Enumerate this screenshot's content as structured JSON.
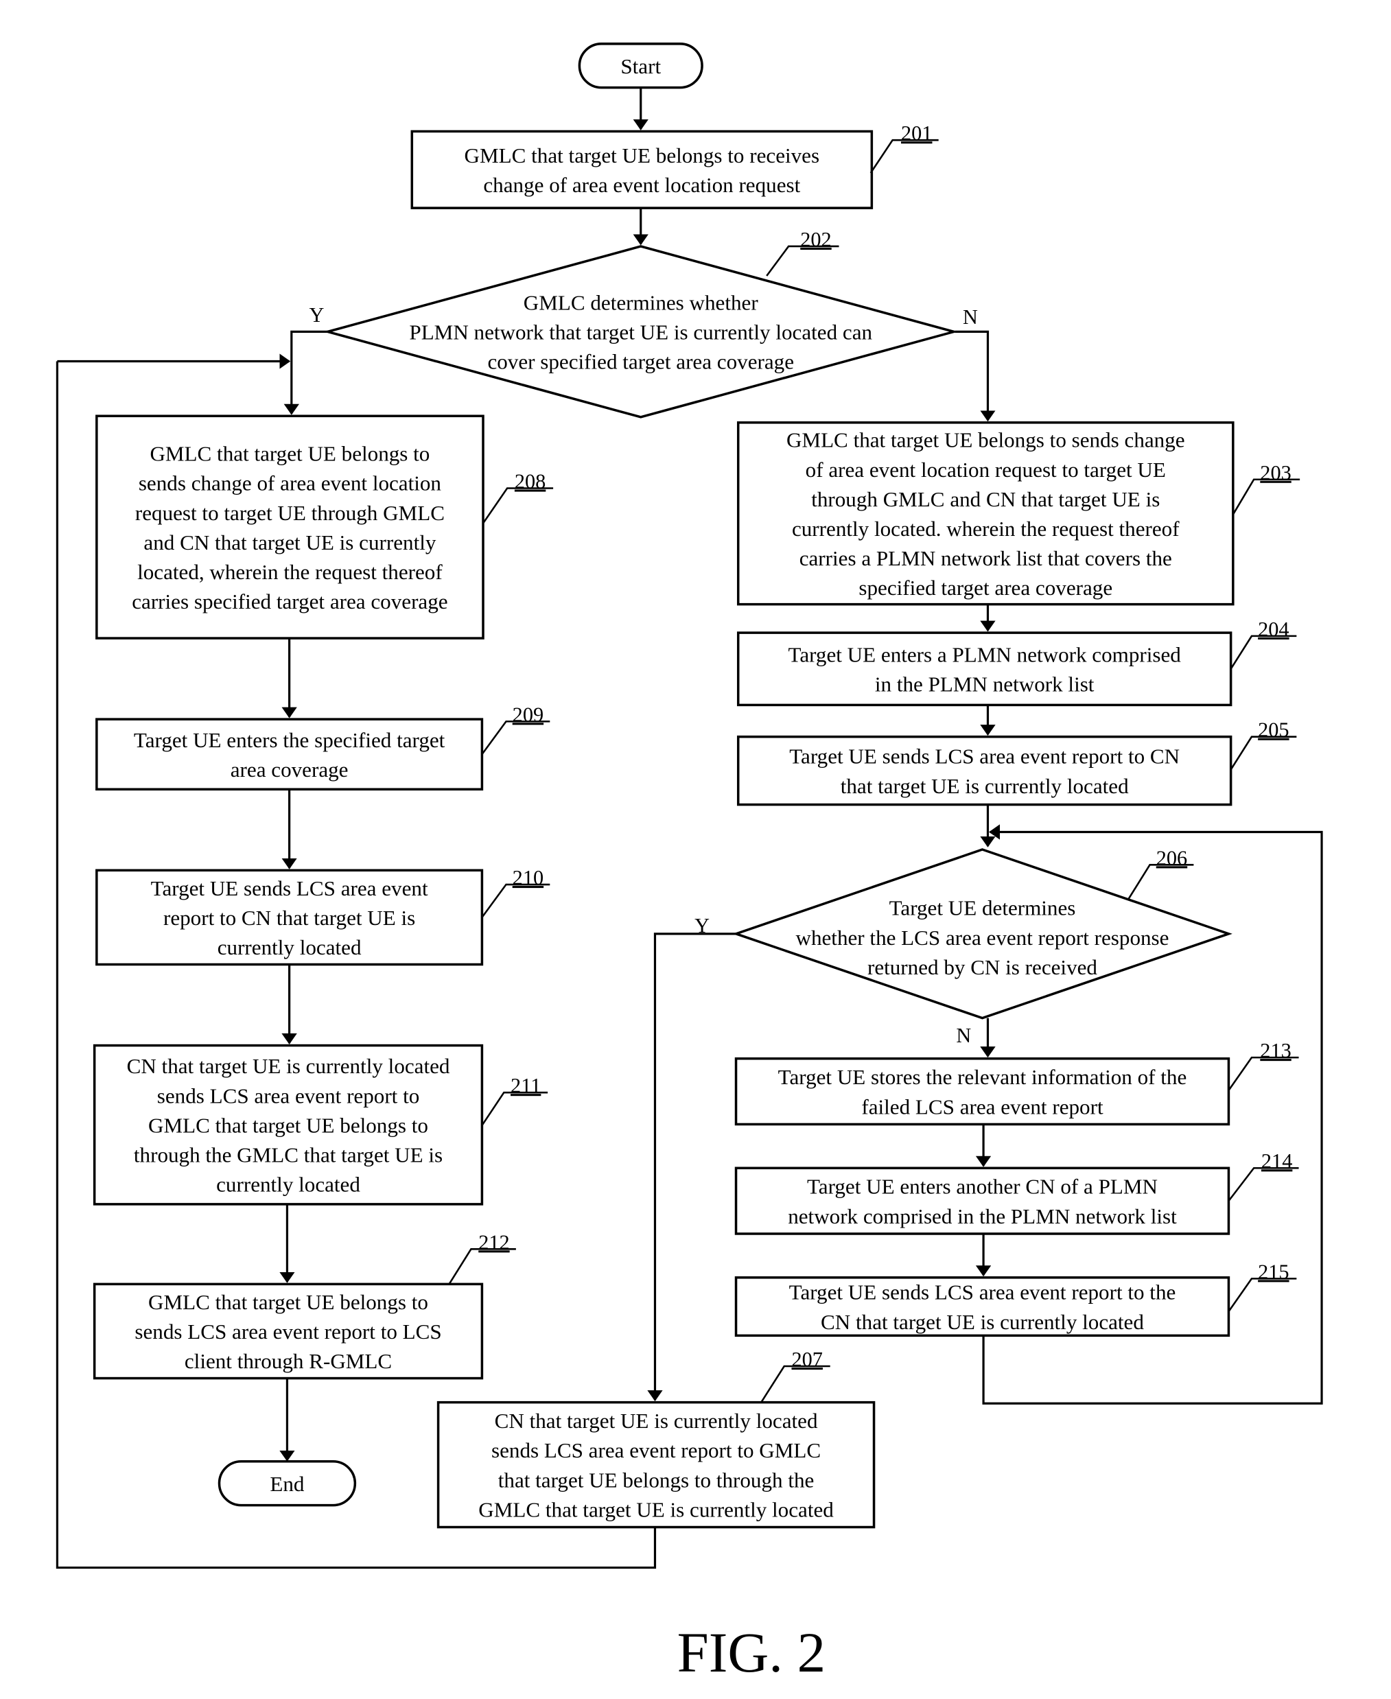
{
  "figure": {
    "caption": "FIG. 2",
    "start_label": "Start",
    "end_label": "End"
  },
  "steps": {
    "s201": {
      "ref": "201",
      "lines": [
        "GMLC that target UE belongs to receives",
        "change of area event location request"
      ]
    },
    "s202": {
      "ref": "202",
      "lines": [
        "GMLC determines whether",
        "PLMN network that target UE is currently located can",
        "cover specified target area coverage"
      ],
      "yes": "Y",
      "no": "N"
    },
    "s203": {
      "ref": "203",
      "lines": [
        "GMLC that target UE belongs to sends change",
        "of area event location request to target UE",
        "through GMLC and CN that target UE is",
        "currently located. wherein the request thereof",
        "carries a PLMN network list that covers the",
        "specified target area coverage"
      ]
    },
    "s204": {
      "ref": "204",
      "lines": [
        "Target UE enters a PLMN network comprised",
        "in the PLMN network list"
      ]
    },
    "s205": {
      "ref": "205",
      "lines": [
        "Target UE sends LCS area event report to CN",
        "that target UE is currently located"
      ]
    },
    "s206": {
      "ref": "206",
      "lines": [
        "Target UE determines",
        "whether the LCS area event report response",
        "returned by CN is received"
      ],
      "yes": "Y",
      "no": "N"
    },
    "s207": {
      "ref": "207",
      "lines": [
        "CN that target UE is currently located",
        "sends LCS area event report to GMLC",
        "that target UE belongs to through the",
        "GMLC that target UE is currently located"
      ]
    },
    "s208": {
      "ref": "208",
      "lines": [
        "GMLC that target UE belongs to",
        "sends change of area event location",
        "request to target UE through GMLC",
        "and CN that target UE is currently",
        "located, wherein the request thereof",
        "carries specified target area coverage"
      ]
    },
    "s209": {
      "ref": "209",
      "lines": [
        "Target UE enters the specified target",
        "area coverage"
      ]
    },
    "s210": {
      "ref": "210",
      "lines": [
        "Target UE sends LCS area event",
        "report to CN that target UE is",
        "currently located"
      ]
    },
    "s211": {
      "ref": "211",
      "lines": [
        "CN that target UE is currently located",
        "sends LCS area event report to",
        "GMLC that target UE belongs to",
        "through the GMLC that target UE is",
        "currently located"
      ]
    },
    "s212": {
      "ref": "212",
      "lines": [
        "GMLC that target UE belongs to",
        "sends LCS area event report to LCS",
        "client through R-GMLC"
      ]
    },
    "s213": {
      "ref": "213",
      "lines": [
        "Target UE stores the relevant information of the",
        "failed LCS area event report"
      ]
    },
    "s214": {
      "ref": "214",
      "lines": [
        "Target UE enters another CN of a PLMN",
        "network comprised in the PLMN network list"
      ]
    },
    "s215": {
      "ref": "215",
      "lines": [
        "Target UE sends LCS area event report to the",
        "CN that target UE is currently located"
      ]
    }
  }
}
